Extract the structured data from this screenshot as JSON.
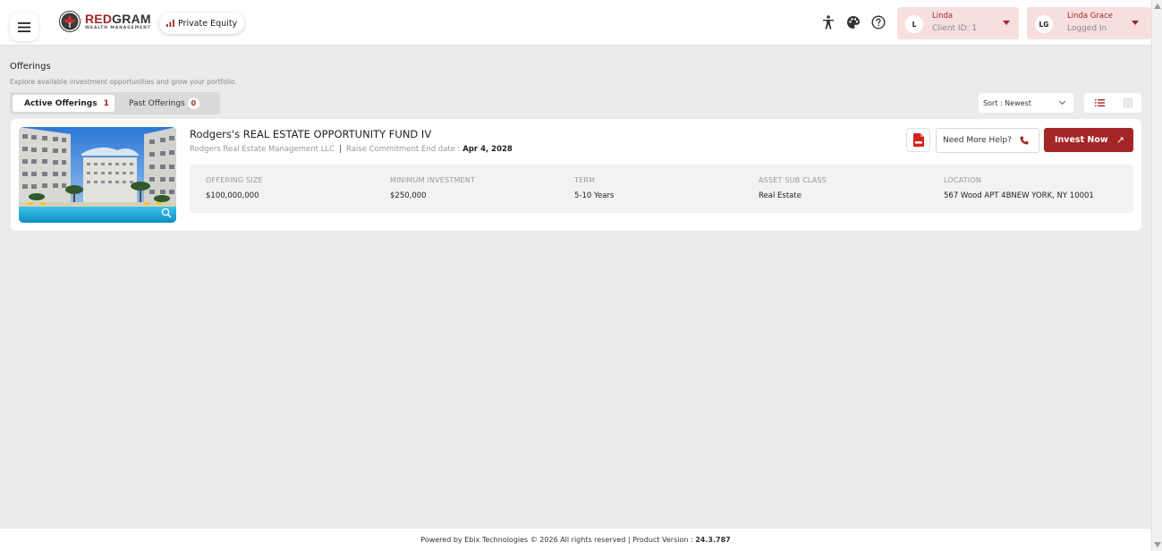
{
  "header": {
    "brand_name_red": "RED",
    "brand_name_dark": "GRAM",
    "brand_tagline": "WEALTH MANAGEMENT",
    "product_pill": "Private Equity",
    "icons": [
      "accessibility-icon",
      "palette-icon",
      "help-circle-icon"
    ],
    "client": {
      "initial": "L",
      "name": "Linda",
      "id_label": "Client ID: 1"
    },
    "user": {
      "initials": "LG",
      "name": "Linda Grace",
      "status": "Logged In"
    }
  },
  "page": {
    "title": "Offerings",
    "subtitle": "Explore available investment opportunities and grow your portfolio."
  },
  "tabs": [
    {
      "label": "Active Offerings",
      "count": "1",
      "active": true
    },
    {
      "label": "Past Offerings",
      "count": "0",
      "active": false
    }
  ],
  "sort": {
    "value": "Sort : Newest"
  },
  "offering": {
    "title": "Rodgers's REAL ESTATE OPPORTUNITY FUND IV",
    "manager": "Rodgers Real Estate Management LLC",
    "commitment_label": "Raise Commitment End date :",
    "commitment_date": "Apr 4, 2028",
    "help_label": "Need More Help?",
    "invest_label": "Invest Now",
    "stats": [
      {
        "label": "OFFERING SIZE",
        "value": "$100,000,000"
      },
      {
        "label": "MINIMUM INVESTMENT",
        "value": "$250,000"
      },
      {
        "label": "TERM",
        "value": "5-10 Years"
      },
      {
        "label": "ASSET SUB CLASS",
        "value": "Real Estate"
      },
      {
        "label": "LOCATION",
        "value": "567 Wood APT 4BNEW YORK, NY 10001"
      }
    ]
  },
  "footer": {
    "text": "Powered by Ebix Technologies © 2026 All rights reserved | Product Version :",
    "version": "24.3.787"
  },
  "colors": {
    "brand": "#a32626",
    "brand_light": "#f7dfe0",
    "page_bg": "#ebebeb"
  }
}
